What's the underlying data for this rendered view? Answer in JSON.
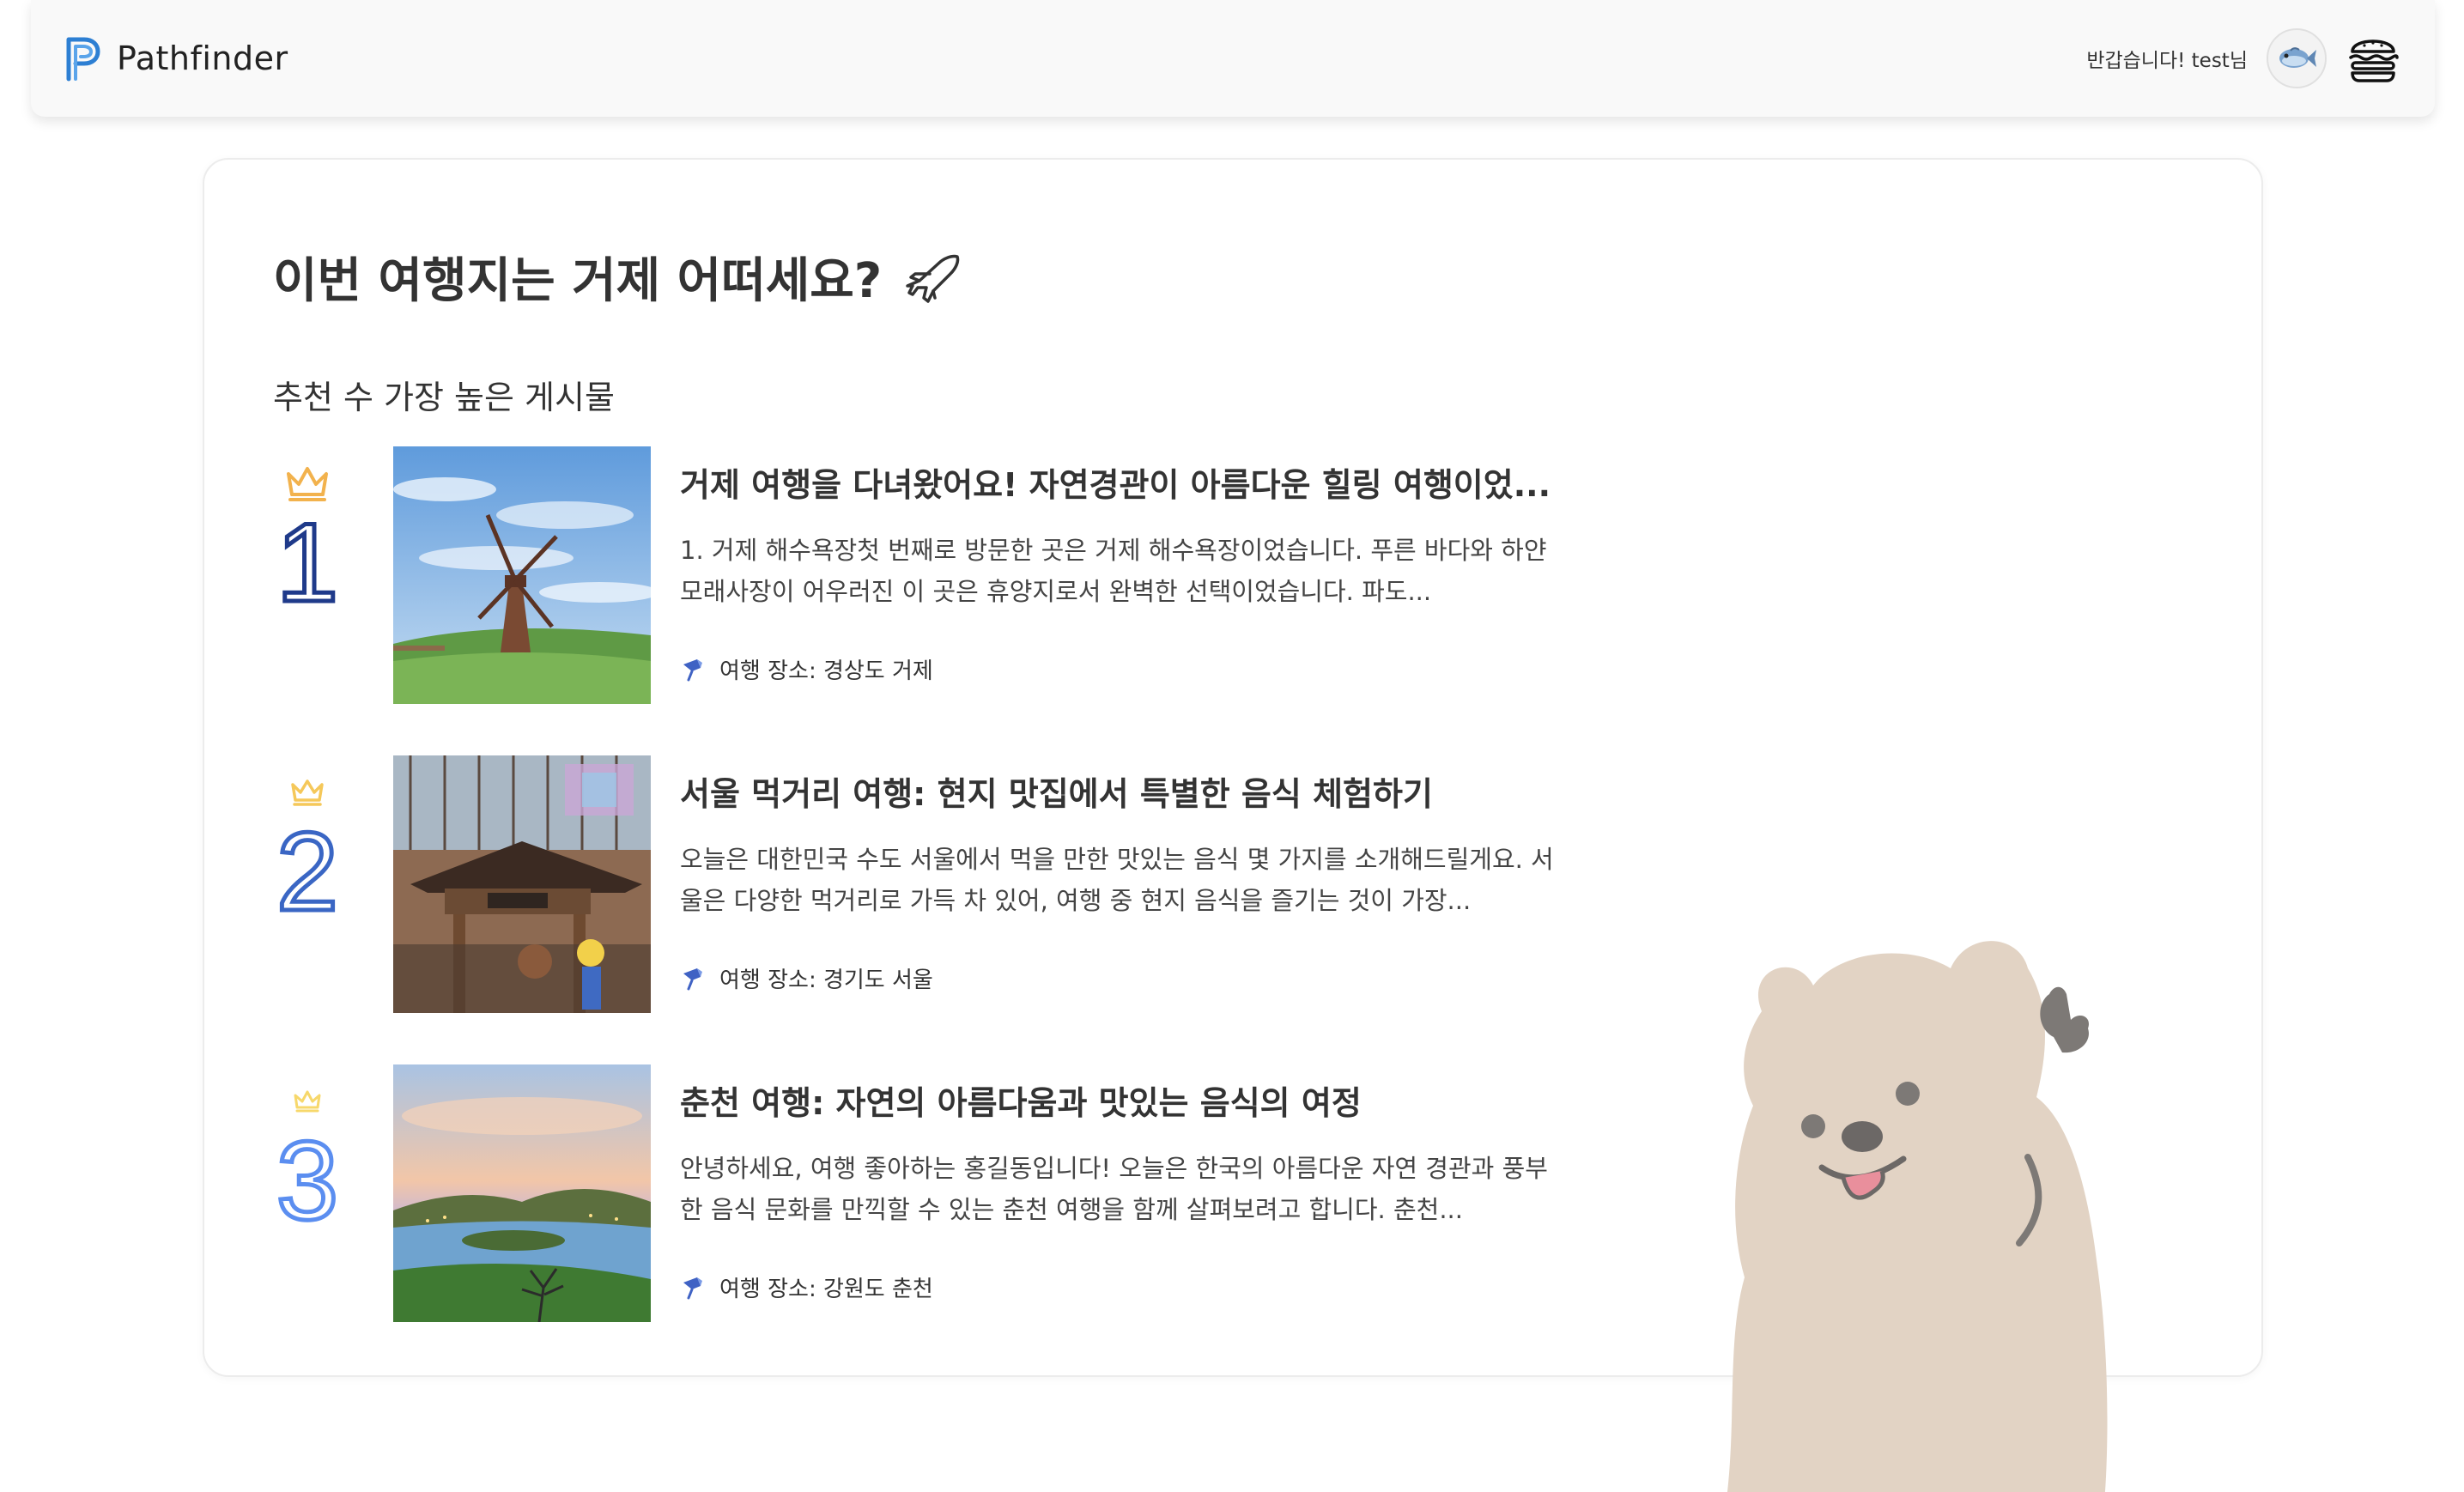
{
  "header": {
    "brand_name": "Pathfinder",
    "greeting": "반갑습니다! test님",
    "avatar_icon": "fish-avatar-icon",
    "menu_icon": "burger-menu-icon"
  },
  "main": {
    "title": "이번 여행지는 거제 어떠세요?",
    "title_icon": "airplane-icon",
    "section_title": "추천 수 가장 높은 게시물",
    "posts": [
      {
        "rank": "1",
        "title": "거제 여행을 다녀왔어요! 자연경관이 아름다운 힐링 여행이었...",
        "excerpt": "1. 거제 해수욕장첫 번째로 방문한 곳은 거제 해수욕장이었습니다. 푸른 바다와 하얀 모래사장이 어우러진 이 곳은 휴양지로서 완벽한 선택이었습니다. 파도...",
        "location": "여행 장소: 경상도 거제",
        "rank_color": "#1f3a8a",
        "crown_color": "#f2b24d"
      },
      {
        "rank": "2",
        "title": "서울 먹거리 여행: 현지 맛집에서 특별한 음식 체험하기",
        "excerpt": "오늘은 대한민국 수도 서울에서 먹을 만한 맛있는 음식 몇 가지를 소개해드릴게요. 서울은 다양한 먹거리로 가득 차 있어, 여행 중 현지 음식을 즐기는 것이 가장...",
        "location": "여행 장소: 경기도 서울",
        "rank_color": "#3a66c4",
        "crown_color": "#f5c85a"
      },
      {
        "rank": "3",
        "title": "춘천 여행: 자연의 아름다움과 맛있는 음식의 여정",
        "excerpt": "안녕하세요, 여행 좋아하는 홍길동입니다! 오늘은 한국의 아름다운 자연 경관과 풍부한 음식 문화를 만끽할 수 있는 춘천 여행을 함께 살펴보려고 합니다. 춘천...",
        "location": "여행 장소: 강원도 춘천",
        "rank_color": "#5b8ef0",
        "crown_color": "#f7d86b"
      }
    ],
    "location_icon": "map-pin-icon",
    "mascot": "quokka-mascot"
  },
  "colors": {
    "accent": "#2d7fd3",
    "text": "#333333",
    "mascot": "#e2d3c4"
  }
}
